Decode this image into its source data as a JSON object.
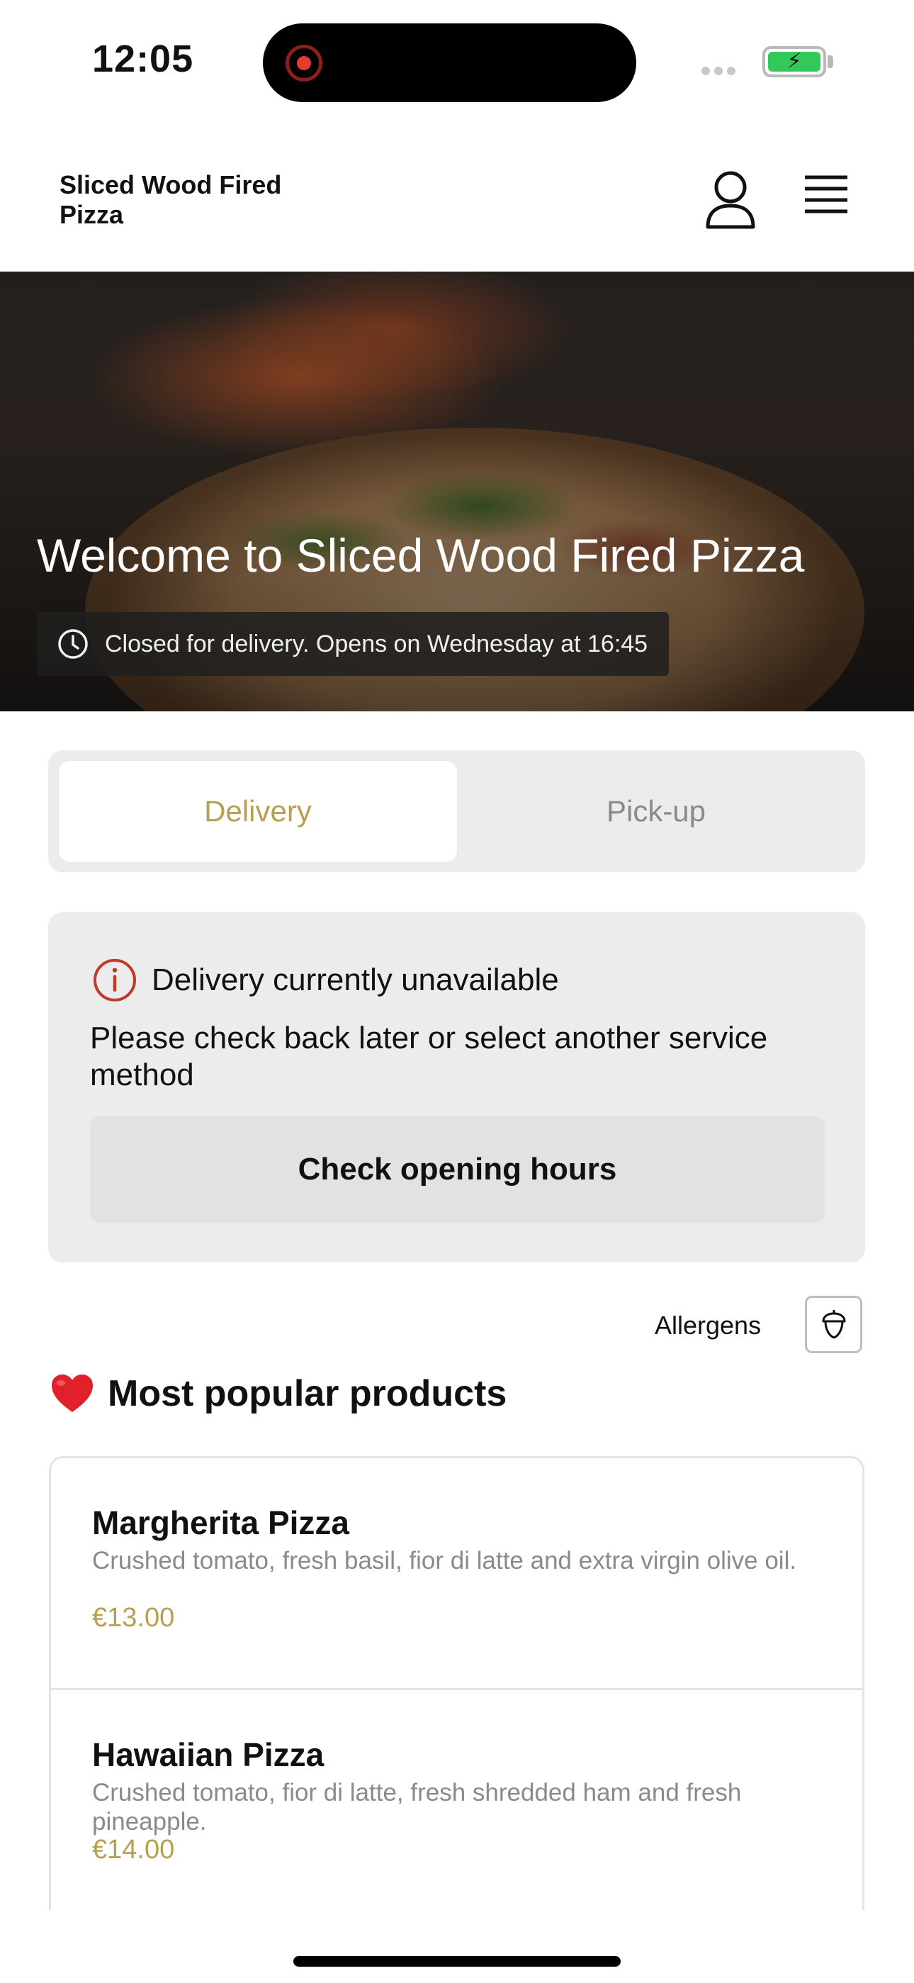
{
  "status_bar": {
    "time": "12:05"
  },
  "header": {
    "brand": "Sliced Wood Fired Pizza"
  },
  "hero": {
    "title": "Welcome to Sliced Wood Fired Pizza",
    "hours_notice": "Closed for delivery. Opens on Wednesday at 16:45"
  },
  "service": {
    "options": [
      "Delivery",
      "Pick-up"
    ],
    "selected": "Delivery"
  },
  "unavailable": {
    "title": "Delivery currently unavailable",
    "message": "Please check back later or select another service method",
    "button": "Check opening hours"
  },
  "allergens": {
    "label": "Allergens"
  },
  "section": {
    "title": "Most popular products"
  },
  "products": [
    {
      "name": "Margherita Pizza",
      "description": "Crushed tomato, fresh basil, fior di latte and extra virgin olive oil.",
      "price": "€13.00"
    },
    {
      "name": "Hawaiian Pizza",
      "description": "Crushed tomato, fior di latte, fresh shredded ham and fresh pineapple.",
      "price": "€14.00"
    }
  ],
  "colors": {
    "accent": "#b8a053",
    "alert": "#c0392b",
    "card_bg": "#ececec"
  },
  "icons": [
    "record-icon",
    "signal-icon",
    "battery-icon",
    "user-icon",
    "menu-icon",
    "clock-icon",
    "info-icon",
    "acorn-icon",
    "heart-icon"
  ]
}
